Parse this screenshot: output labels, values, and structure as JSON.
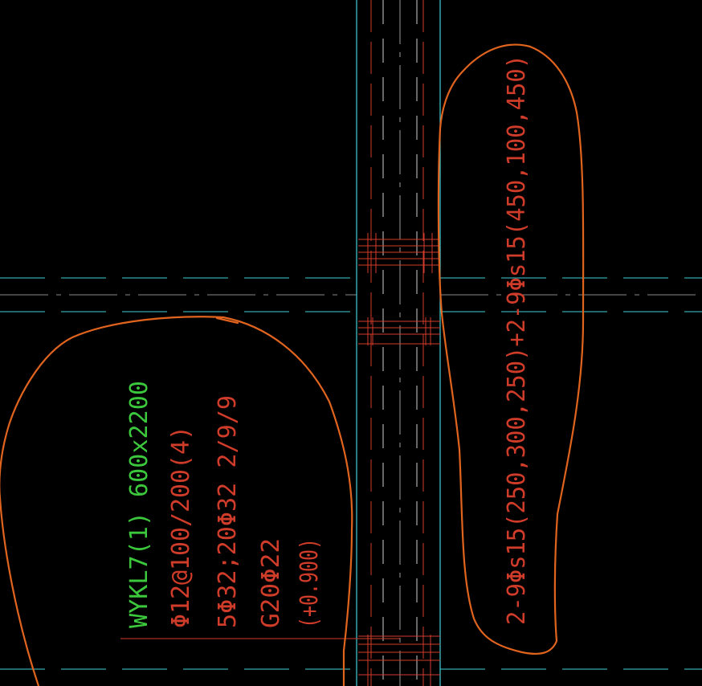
{
  "colors": {
    "background": "#000000",
    "grid_axis": "#3fd0d8",
    "rebar": "#d03c2a",
    "label_green": "#3cc83c",
    "label_red": "#d03c2a",
    "markup": "#e0641e"
  },
  "beam_label": {
    "name_size": "WYKL7(1) 600x2200",
    "stirrup": "Φ12@100/200(4)",
    "top_bottom_bars": "5Φ32;20Φ32 2/9/9",
    "side_bars": "G20Φ22",
    "elevation": "(+0.900)"
  },
  "prestress_label": {
    "tendons": "2-9Φs15(250,300,250)+2-9Φs15(450,100,450)"
  }
}
